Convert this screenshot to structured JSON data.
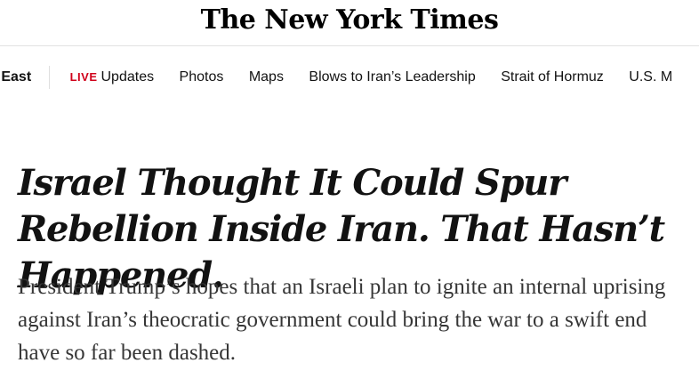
{
  "masthead": {
    "logo_text": "The New York Times"
  },
  "nav": {
    "section": "e East",
    "live": {
      "badge": "LIVE",
      "label": "Updates"
    },
    "items": [
      "Photos",
      "Maps",
      "Blows to Iran’s Leadership",
      "Strait of Hormuz",
      "U.S. M"
    ]
  },
  "article": {
    "headline": "Israel Thought It Could Spur Rebellion Inside Iran. That Hasn’t Happened.",
    "summary": "President Trump’s hopes that an Israeli plan to ignite an internal uprising against Iran’s theocratic government could bring the war to a swift end have so far been dashed."
  }
}
